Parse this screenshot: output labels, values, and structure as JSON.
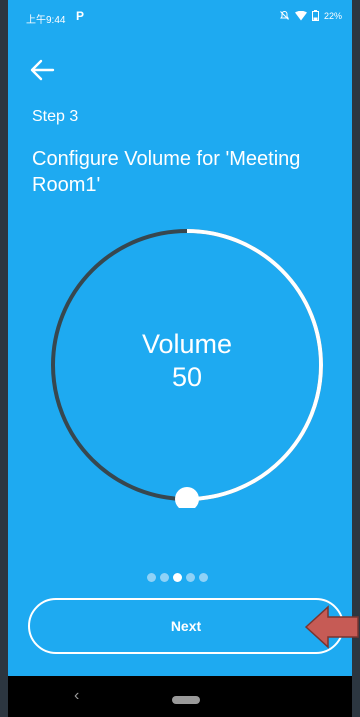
{
  "status_bar": {
    "time": "上午9:44",
    "app_icon_letter": "P",
    "battery": "22%"
  },
  "header": {
    "step": "Step 3",
    "title": "Configure Volume for 'Meeting Room1'"
  },
  "volume": {
    "label": "Volume",
    "value": 50,
    "min": 0,
    "max": 100
  },
  "pager": {
    "count": 5,
    "active_index": 2
  },
  "footer": {
    "next_label": "Next"
  },
  "colors": {
    "background": "#1eaaf1",
    "track": "#37474f",
    "accent": "#ffffff",
    "annotation_arrow": "#c65b55"
  },
  "icons": [
    "arrow-left-icon",
    "mute-icon",
    "wifi-icon",
    "battery-icon",
    "back-triangle-icon",
    "home-pill-icon"
  ]
}
